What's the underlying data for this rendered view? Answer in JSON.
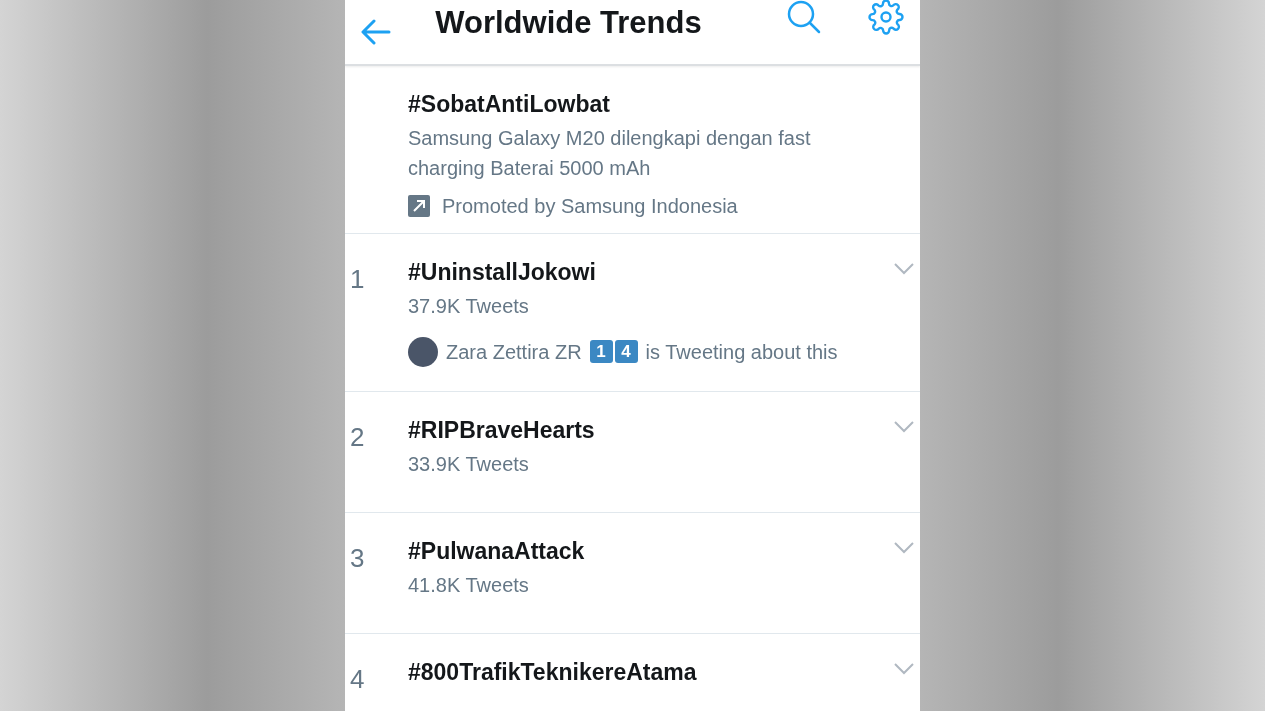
{
  "header": {
    "title": "Worldwide Trends"
  },
  "promoted": {
    "hashtag": "#SobatAntiLowbat",
    "description": "Samsung Galaxy M20 dilengkapi dengan fast charging Baterai 5000 mAh",
    "sponsor": "Promoted by Samsung Indonesia"
  },
  "trends": [
    {
      "rank": "1",
      "hashtag": "#UninstallJokowi",
      "count": "37.9K Tweets",
      "tweeting": {
        "name": "Zara Zettira ZR",
        "badges": [
          "1",
          "4"
        ],
        "suffix": "is Tweeting about this"
      }
    },
    {
      "rank": "2",
      "hashtag": "#RIPBraveHearts",
      "count": "33.9K Tweets"
    },
    {
      "rank": "3",
      "hashtag": "#PulwanaAttack",
      "count": "41.8K Tweets"
    },
    {
      "rank": "4",
      "hashtag": "#800TrafikTeknikereAtama"
    }
  ]
}
